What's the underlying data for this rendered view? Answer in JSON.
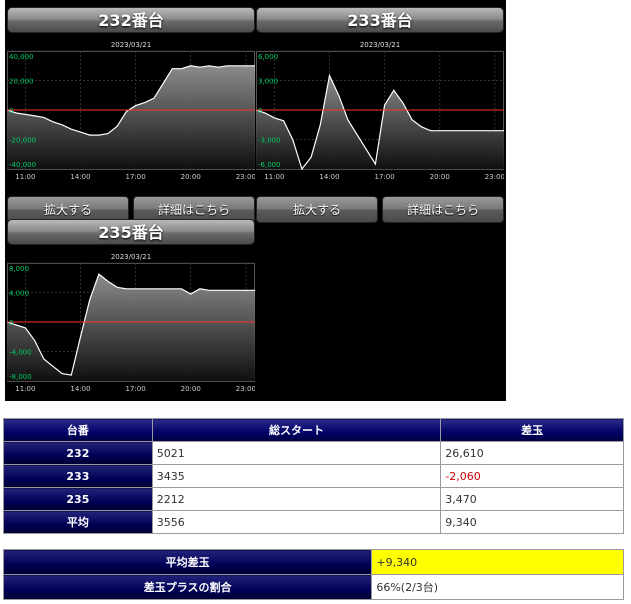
{
  "panels": [
    {
      "title": "232番台",
      "date": "2023/03/21",
      "ylabels": [
        "40,000",
        "20,000",
        "0",
        "-20,000",
        "-40,000"
      ],
      "xlabels": [
        "11:00",
        "14:00",
        "17:00",
        "20:00",
        "23:00"
      ],
      "buttons": {
        "zoom": "拡大する",
        "details": "詳細はこちら"
      }
    },
    {
      "title": "233番台",
      "date": "2023/03/21",
      "ylabels": [
        "6,000",
        "3,000",
        "0",
        "-3,000",
        "-6,000"
      ],
      "xlabels": [
        "11:00",
        "14:00",
        "17:00",
        "20:00",
        "23:00"
      ],
      "buttons": {
        "zoom": "拡大する",
        "details": "詳細はこちら"
      }
    },
    {
      "title": "235番台",
      "date": "2023/03/21",
      "ylabels": [
        "8,000",
        "4,000",
        "0",
        "-4,000",
        "-8,000"
      ],
      "xlabels": [
        "11:00",
        "14:00",
        "17:00",
        "20:00",
        "23:00"
      ]
    }
  ],
  "table": {
    "headers": [
      "台番",
      "総スタート",
      "差玉"
    ],
    "rows": [
      {
        "id": "232",
        "starts": "5021",
        "diff": "26,610"
      },
      {
        "id": "233",
        "starts": "3435",
        "diff": "-2,060"
      },
      {
        "id": "235",
        "starts": "2212",
        "diff": "3,470"
      },
      {
        "id": "平均",
        "starts": "3556",
        "diff": "9,340"
      }
    ]
  },
  "stats": {
    "avg_label": "平均差玉",
    "avg_value": "+9,340",
    "ratio_label": "差玉プラスの割合",
    "ratio_value": "66%(2/3台)"
  },
  "colors": {
    "negative": "#cc0000",
    "highlight": "#ffff00",
    "header_bg": "#000066",
    "zero_line": "#ff3333",
    "axis_text": "#00cc66"
  },
  "chart_data": [
    {
      "type": "area",
      "title": "2023/03/21",
      "x": [
        "10:00",
        "10:30",
        "11:00",
        "11:30",
        "12:00",
        "12:30",
        "13:00",
        "13:30",
        "14:00",
        "14:30",
        "15:00",
        "15:30",
        "16:00",
        "16:30",
        "17:00",
        "17:30",
        "18:00",
        "18:30",
        "19:00",
        "19:30",
        "20:00",
        "20:30",
        "21:00",
        "21:30",
        "22:00",
        "22:30",
        "23:00",
        "23:30"
      ],
      "values": [
        0,
        -2000,
        -3000,
        -4000,
        -5000,
        -8000,
        -10000,
        -13000,
        -15000,
        -17000,
        -17000,
        -16000,
        -11000,
        -1000,
        3000,
        5000,
        8000,
        18000,
        28000,
        28000,
        30000,
        29000,
        30000,
        29000,
        30000,
        30000,
        30000,
        30000
      ],
      "ylim": [
        -40000,
        40000
      ],
      "zero_line": true
    },
    {
      "type": "area",
      "title": "2023/03/21",
      "x": [
        "10:00",
        "10:30",
        "11:00",
        "11:30",
        "12:00",
        "12:30",
        "13:00",
        "13:30",
        "14:00",
        "14:30",
        "15:00",
        "15:30",
        "16:00",
        "16:30",
        "17:00",
        "17:30",
        "18:00",
        "18:30",
        "19:00",
        "19:30",
        "20:00",
        "20:30",
        "21:00",
        "21:30",
        "22:00",
        "22:30",
        "23:00",
        "23:30"
      ],
      "values": [
        0,
        -300,
        -800,
        -1100,
        -3000,
        -6000,
        -4800,
        -1500,
        3500,
        1500,
        -1000,
        -2500,
        -4000,
        -5500,
        500,
        2000,
        700,
        -1000,
        -1700,
        -2100,
        -2100,
        -2100,
        -2100,
        -2100,
        -2100,
        -2100,
        -2100,
        -2100
      ],
      "ylim": [
        -6000,
        6000
      ],
      "zero_line": true
    },
    {
      "type": "area",
      "title": "2023/03/21",
      "x": [
        "10:00",
        "10:30",
        "11:00",
        "11:30",
        "12:00",
        "12:30",
        "13:00",
        "13:30",
        "14:00",
        "14:30",
        "15:00",
        "15:30",
        "16:00",
        "16:30",
        "17:00",
        "17:30",
        "18:00",
        "18:30",
        "19:00",
        "19:30",
        "20:00",
        "20:30",
        "21:00",
        "21:30",
        "22:00",
        "22:30",
        "23:00",
        "23:30"
      ],
      "values": [
        0,
        -400,
        -800,
        -2500,
        -5000,
        -6000,
        -7000,
        -7200,
        -2000,
        3000,
        6500,
        5500,
        4700,
        4500,
        4500,
        4500,
        4500,
        4500,
        4500,
        4500,
        3800,
        4500,
        4300,
        4300,
        4300,
        4300,
        4300,
        4300
      ],
      "ylim": [
        -8000,
        8000
      ],
      "zero_line": true
    }
  ]
}
